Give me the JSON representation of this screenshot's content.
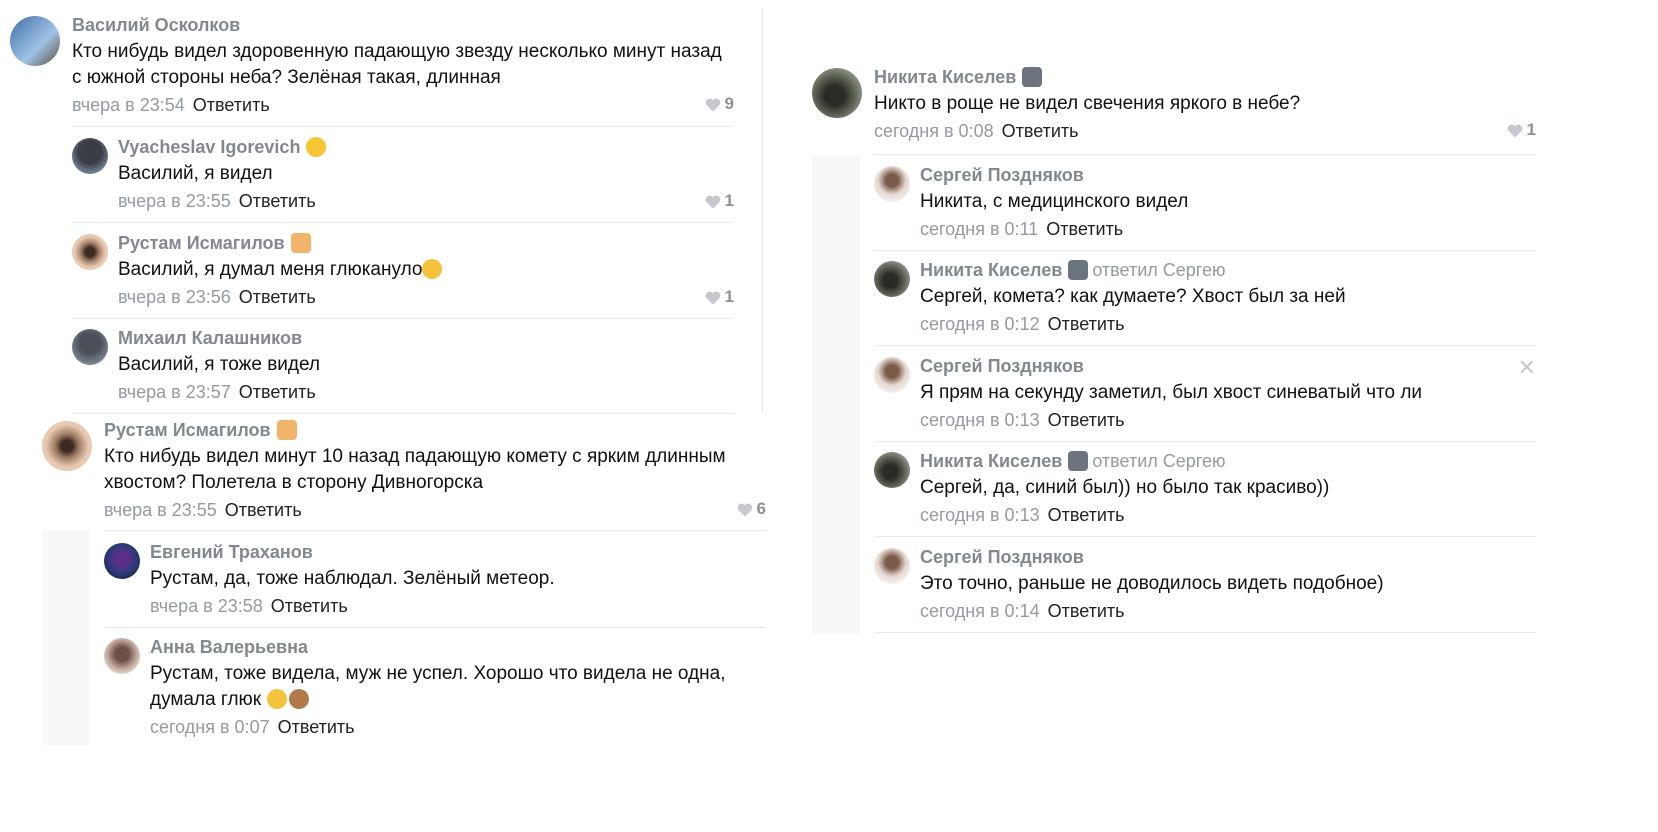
{
  "left_thread": {
    "root": {
      "author": "Василий Осколков",
      "text": "Кто нибудь видел здоровенную падающую звезду несколько минут назад с южной стороны неба? Зелёная такая, длинная",
      "time": "вчера в 23:54",
      "reply": "Ответить",
      "likes": "9"
    },
    "replies": [
      {
        "author": "Vyacheslav Igorevich",
        "text": "Василий, я видел",
        "time": "вчера в 23:55",
        "reply": "Ответить",
        "likes": "1"
      },
      {
        "author": "Рустам Исмагилов",
        "text": "Василий, я думал меня глюкануло",
        "time": "вчера в 23:56",
        "reply": "Ответить",
        "likes": "1"
      },
      {
        "author": "Михаил Калашников",
        "text": "Василий, я тоже видел",
        "time": "вчера в 23:57",
        "reply": "Ответить"
      }
    ]
  },
  "left_thread2": {
    "root": {
      "author": "Рустам Исмагилов",
      "text": "Кто нибудь видел минут 10 назад падающую комету с ярким длинным хвостом? Полетела в сторону Дивногорска",
      "time": "вчера в 23:55",
      "reply": "Ответить",
      "likes": "6"
    },
    "replies": [
      {
        "author": "Евгений Траханов",
        "text": "Рустам, да, тоже наблюдал. Зелёный метеор.",
        "time": "вчера в 23:58",
        "reply": "Ответить"
      },
      {
        "author": "Анна Валерьевна",
        "text": "Рустам, тоже видела, муж не успел. Хорошо что видела не одна, думала глюк",
        "time": "сегодня в 0:07",
        "reply": "Ответить"
      }
    ]
  },
  "right_thread": {
    "root": {
      "author": "Никита Киселев",
      "text": "Никто в роще не видел свечения яркого в небе?",
      "time": "сегодня в 0:08",
      "reply": "Ответить",
      "likes": "1"
    },
    "replies": [
      {
        "author": "Сергей Поздняков",
        "text": "Никита, с медицинского видел",
        "time": "сегодня в 0:11",
        "reply": "Ответить"
      },
      {
        "author": "Никита Киселев",
        "replied_to": "ответил Сергею",
        "text": "Сергей, комета? как думаете? Хвост был за ней",
        "time": "сегодня в 0:12",
        "reply": "Ответить"
      },
      {
        "author": "Сергей Поздняков",
        "text": "Я прям на секунду заметил, был хвост синеватый что ли",
        "time": "сегодня в 0:13",
        "reply": "Ответить"
      },
      {
        "author": "Никита Киселев",
        "replied_to": "ответил Сергею",
        "text": "Сергей, да, синий был)) но было так красиво))",
        "time": "сегодня в 0:13",
        "reply": "Ответить"
      },
      {
        "author": "Сергей Поздняков",
        "text": "Это точно, раньше не доводилось видеть подобное)",
        "time": "сегодня в 0:14",
        "reply": "Ответить"
      }
    ]
  },
  "icons": {
    "like": "heart-icon",
    "close": "close-icon"
  },
  "colors": {
    "author": "#828891",
    "meta": "#939aa3",
    "separator": "#e7e8ec",
    "thread_bg": "#f7f8fa"
  }
}
